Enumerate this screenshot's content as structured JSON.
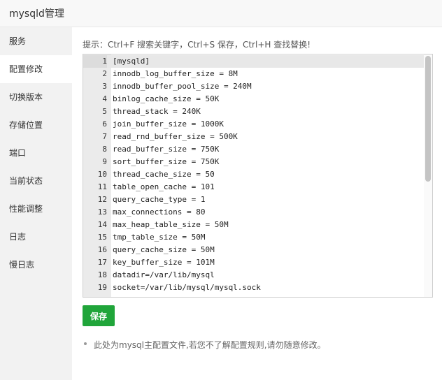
{
  "window": {
    "title": "mysqld管理"
  },
  "sidebar": {
    "items": [
      {
        "label": "服务"
      },
      {
        "label": "配置修改",
        "active": true
      },
      {
        "label": "切换版本"
      },
      {
        "label": "存储位置"
      },
      {
        "label": "端口"
      },
      {
        "label": "当前状态"
      },
      {
        "label": "性能调整"
      },
      {
        "label": "日志"
      },
      {
        "label": "慢日志"
      }
    ]
  },
  "main": {
    "hint": "提示：Ctrl+F 搜索关键字，Ctrl+S 保存，Ctrl+H 查找替换!",
    "editor": {
      "current_line": 1,
      "lines": [
        {
          "n": "1",
          "text": "[mysqld]"
        },
        {
          "n": "2",
          "text": "innodb_log_buffer_size = 8M"
        },
        {
          "n": "3",
          "text": "innodb_buffer_pool_size = 240M"
        },
        {
          "n": "4",
          "text": "binlog_cache_size = 50K"
        },
        {
          "n": "5",
          "text": "thread_stack = 240K"
        },
        {
          "n": "6",
          "text": "join_buffer_size = 1000K"
        },
        {
          "n": "7",
          "text": "read_rnd_buffer_size = 500K"
        },
        {
          "n": "8",
          "text": "read_buffer_size = 750K"
        },
        {
          "n": "9",
          "text": "sort_buffer_size = 750K"
        },
        {
          "n": "10",
          "text": "thread_cache_size = 50"
        },
        {
          "n": "11",
          "text": "table_open_cache = 101"
        },
        {
          "n": "12",
          "text": "query_cache_type = 1"
        },
        {
          "n": "13",
          "text": "max_connections = 80"
        },
        {
          "n": "14",
          "text": "max_heap_table_size = 50M"
        },
        {
          "n": "15",
          "text": "tmp_table_size = 50M"
        },
        {
          "n": "16",
          "text": "query_cache_size = 50M"
        },
        {
          "n": "17",
          "text": "key_buffer_size = 101M"
        },
        {
          "n": "18",
          "text": "datadir=/var/lib/mysql"
        },
        {
          "n": "19",
          "text": "socket=/var/lib/mysql/mysql.sock"
        }
      ]
    },
    "save_label": "保存",
    "note": "此处为mysql主配置文件,若您不了解配置规则,请勿随意修改。"
  },
  "colors": {
    "accent": "#20a53a",
    "sidebar_bg": "#f2f2f2",
    "gutter_bg": "#ebebeb"
  }
}
